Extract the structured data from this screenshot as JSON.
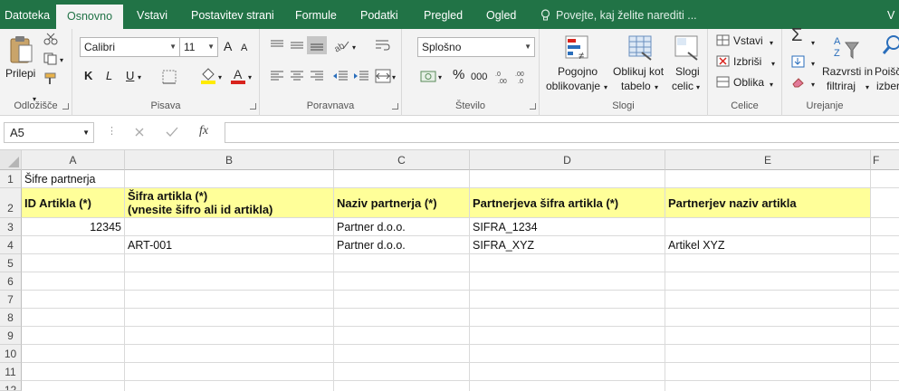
{
  "tabs": {
    "file": "Datoteka",
    "home": "Osnovno",
    "insert": "Vstavi",
    "layout": "Postavitev strani",
    "formulas": "Formule",
    "data": "Podatki",
    "review": "Pregled",
    "view": "Ogled",
    "tellme": "Povejte, kaj želite narediti ...",
    "extra": "V"
  },
  "ribbon": {
    "clipboard": {
      "paste": "Prilepi",
      "label": "Odložišče"
    },
    "font": {
      "name": "Calibri",
      "size": "11",
      "bold": "K",
      "italic": "L",
      "underline": "U",
      "grow": "A",
      "shrink": "A",
      "label": "Pisava"
    },
    "alignment": {
      "label": "Poravnava"
    },
    "number": {
      "format": "Splošno",
      "percent": "%",
      "comma": "000",
      "label": "Število"
    },
    "styles": {
      "conditional": "Pogojno",
      "conditional2": "oblikovanje",
      "table": "Oblikuj kot",
      "table2": "tabelo",
      "cell": "Slogi",
      "cell2": "celic",
      "label": "Slogi"
    },
    "cells": {
      "insert": "Vstavi",
      "delete": "Izbriši",
      "format": "Oblika",
      "label": "Celice"
    },
    "editing": {
      "sort": "Razvrsti in",
      "sort2": "filtriraj",
      "find": "Poišč",
      "find2": "izber",
      "label": "Urejanje"
    }
  },
  "formula_bar": {
    "name_box": "A5",
    "fx": "fx",
    "content": ""
  },
  "columns": [
    "A",
    "B",
    "C",
    "D",
    "E",
    "F"
  ],
  "rows": [
    "1",
    "2",
    "3",
    "4",
    "5",
    "6",
    "7",
    "8",
    "9",
    "10",
    "11",
    "12"
  ],
  "sheet": {
    "title": "Šifre partnerja",
    "headers": {
      "a": "ID Artikla (*)",
      "b1": "Šifra artikla (*)",
      "b2": "(vnesite šifro ali id artikla)",
      "c": "Naziv partnerja (*)",
      "d": "Partnerjeva šifra artikla (*)",
      "e": "Partnerjev naziv artikla"
    },
    "row3": {
      "a": "12345",
      "b": "",
      "c": "Partner d.o.o.",
      "d": "SIFRA_1234",
      "e": ""
    },
    "row4": {
      "a": "",
      "b": "ART-001",
      "c": "Partner d.o.o.",
      "d": "SIFRA_XYZ",
      "e": "Artikel XYZ"
    }
  },
  "colors": {
    "brand": "#217346",
    "header_fill": "#ffff99"
  }
}
